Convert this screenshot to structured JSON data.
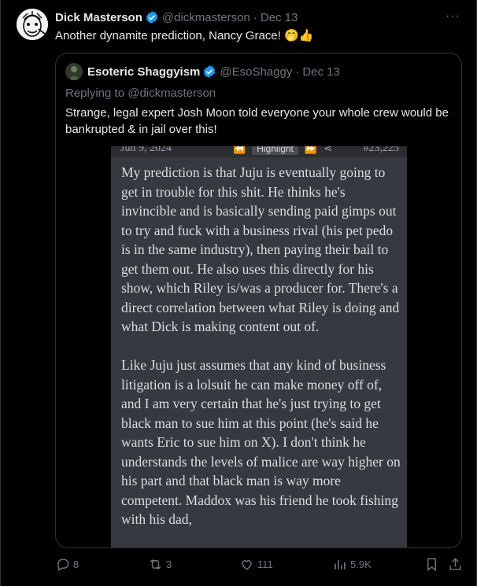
{
  "post": {
    "author_name": "Dick Masterson",
    "author_handle": "@dickmasterson",
    "date": "Dec 13",
    "text": "Another dynamite prediction, Nancy Grace! 🤭👍",
    "more": "···"
  },
  "quoted": {
    "author_name": "Esoteric Shaggyism",
    "author_handle": "@EsoShaggy",
    "date": "Dec 13",
    "replying_to": "Replying to @dickmasterson",
    "text": "Strange, legal expert Josh Moon told everyone your whole crew would be bankrupted & in jail over this!",
    "screenshot": {
      "date": "Jun 9, 2024",
      "highlight_label": "Highlight",
      "post_number": "#23,225",
      "paragraph1": "My prediction is that Juju is eventually going to get in trouble for this shit. He thinks he's invincible and is basically sending paid gimps out to try and fuck with a business rival (his pet pedo is in the same industry), then paying their bail to get them out. He also uses this directly for his show, which Riley is/was a producer for. There's a direct correlation between what Riley is doing and what Dick is making content out of.",
      "paragraph2": "Like Juju just assumes that any kind of business litigation is a lolsuit he can make money off of, and I am very certain that he's just trying to get black man to sue him at this point (he's said he wants Eric to sue him on X). I don't think he understands the levels of malice are way higher on his part and that black man is way more competent. Maddox was his friend he took fishing with his dad,"
    }
  },
  "actions": {
    "replies": "8",
    "reposts": "3",
    "likes": "111",
    "views": "5.9K"
  },
  "colors": {
    "background": "#000000",
    "text": "#e7e9ea",
    "muted": "#71767b",
    "verified": "#1d9bf0",
    "border": "#2f3336"
  }
}
